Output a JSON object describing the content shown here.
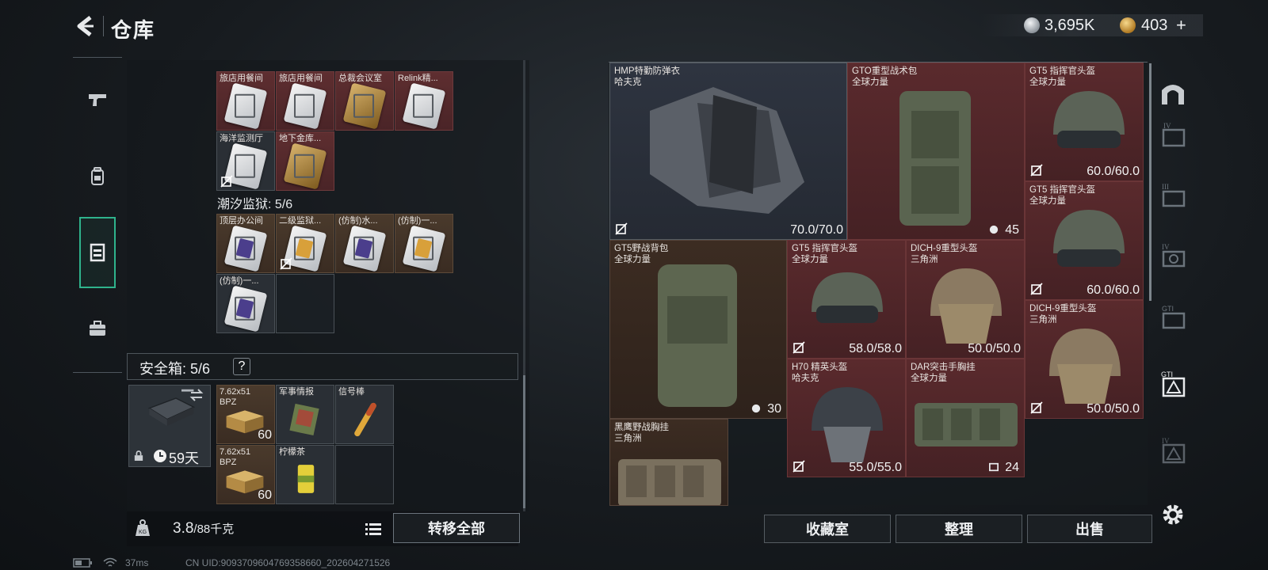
{
  "header": {
    "title": "仓库",
    "currency_silver": "3,695K",
    "currency_gold": "403",
    "currency_plus": "+"
  },
  "left_tabs": [
    {
      "name": "weapons",
      "icon": "pistol-icon"
    },
    {
      "name": "equipment",
      "icon": "backpack-icon"
    },
    {
      "name": "storage",
      "icon": "storage-box-icon"
    },
    {
      "name": "case",
      "icon": "briefcase-icon"
    }
  ],
  "keys_section_1": {
    "items": [
      {
        "label": "旅店用餐间",
        "card": "white",
        "bg": "red"
      },
      {
        "label": "旅店用餐间",
        "card": "white",
        "bg": "red"
      },
      {
        "label": "总裁会议室",
        "card": "gold",
        "bg": "red"
      },
      {
        "label": "Relink精...",
        "card": "white",
        "bg": "red"
      },
      {
        "label": "海洋监测厅",
        "card": "white",
        "bg": "gray",
        "unbound": true
      },
      {
        "label": "地下金库...",
        "card": "gold",
        "bg": "red"
      }
    ]
  },
  "keys_section_2": {
    "title": "潮汐监狱: 5/6",
    "items": [
      {
        "label": "顶层办公间",
        "card": "purple",
        "bg": "brown"
      },
      {
        "label": "二级监狱...",
        "card": "yellow",
        "bg": "brown",
        "unbound": true
      },
      {
        "label": "(仿制)水...",
        "card": "purple",
        "bg": "brown"
      },
      {
        "label": "(仿制)一...",
        "card": "yellow",
        "bg": "brown"
      },
      {
        "label": "(仿制)一...",
        "card": "purple",
        "bg": "gray"
      }
    ]
  },
  "safe_box": {
    "title": "安全箱: 5/6",
    "help": "?",
    "days": "59天",
    "items": [
      {
        "label": "7.62x51 BPZ",
        "qty": "60"
      },
      {
        "label": "军事情报",
        "qty": ""
      },
      {
        "label": "信号棒",
        "qty": ""
      },
      {
        "label": "7.62x51 BPZ",
        "qty": "60"
      },
      {
        "label": "柠檬茶",
        "qty": ""
      }
    ]
  },
  "weight": {
    "current": "3.8",
    "max": "/88千克"
  },
  "buttons": {
    "move_all": "转移全部",
    "collection": "收藏室",
    "organize": "整理",
    "sell": "出售"
  },
  "inventory": [
    {
      "name": "HMP特勤防弹衣",
      "brand": "哈夫克",
      "value": "70.0/70.0"
    },
    {
      "name": "GTO重型战术包",
      "brand": "全球力量",
      "value": "45"
    },
    {
      "name": "GT5 指挥官头盔",
      "brand": "全球力量",
      "value": "60.0/60.0"
    },
    {
      "name": "GT5 指挥官头盔",
      "brand": "全球力量",
      "value": "60.0/60.0"
    },
    {
      "name": "GT5野战背包",
      "brand": "全球力量",
      "value": "30"
    },
    {
      "name": "GT5 指挥官头盔",
      "brand": "全球力量",
      "value": "58.0/58.0"
    },
    {
      "name": "DICH-9重型头盔",
      "brand": "三角洲",
      "value": "50.0/50.0"
    },
    {
      "name": "DICH-9重型头盔",
      "brand": "三角洲",
      "value": "50.0/50.0"
    },
    {
      "name": "H70 精英头盔",
      "brand": "哈夫克",
      "value": "55.0/55.0"
    },
    {
      "name": "DAR突击手胸挂",
      "brand": "全球力量",
      "value": "24"
    },
    {
      "name": "黑鹰野战胸挂",
      "brand": "三角洲",
      "value": ""
    }
  ],
  "status": {
    "ping": "37ms",
    "uid": "CN UID:9093709604769358660_202604271526"
  }
}
